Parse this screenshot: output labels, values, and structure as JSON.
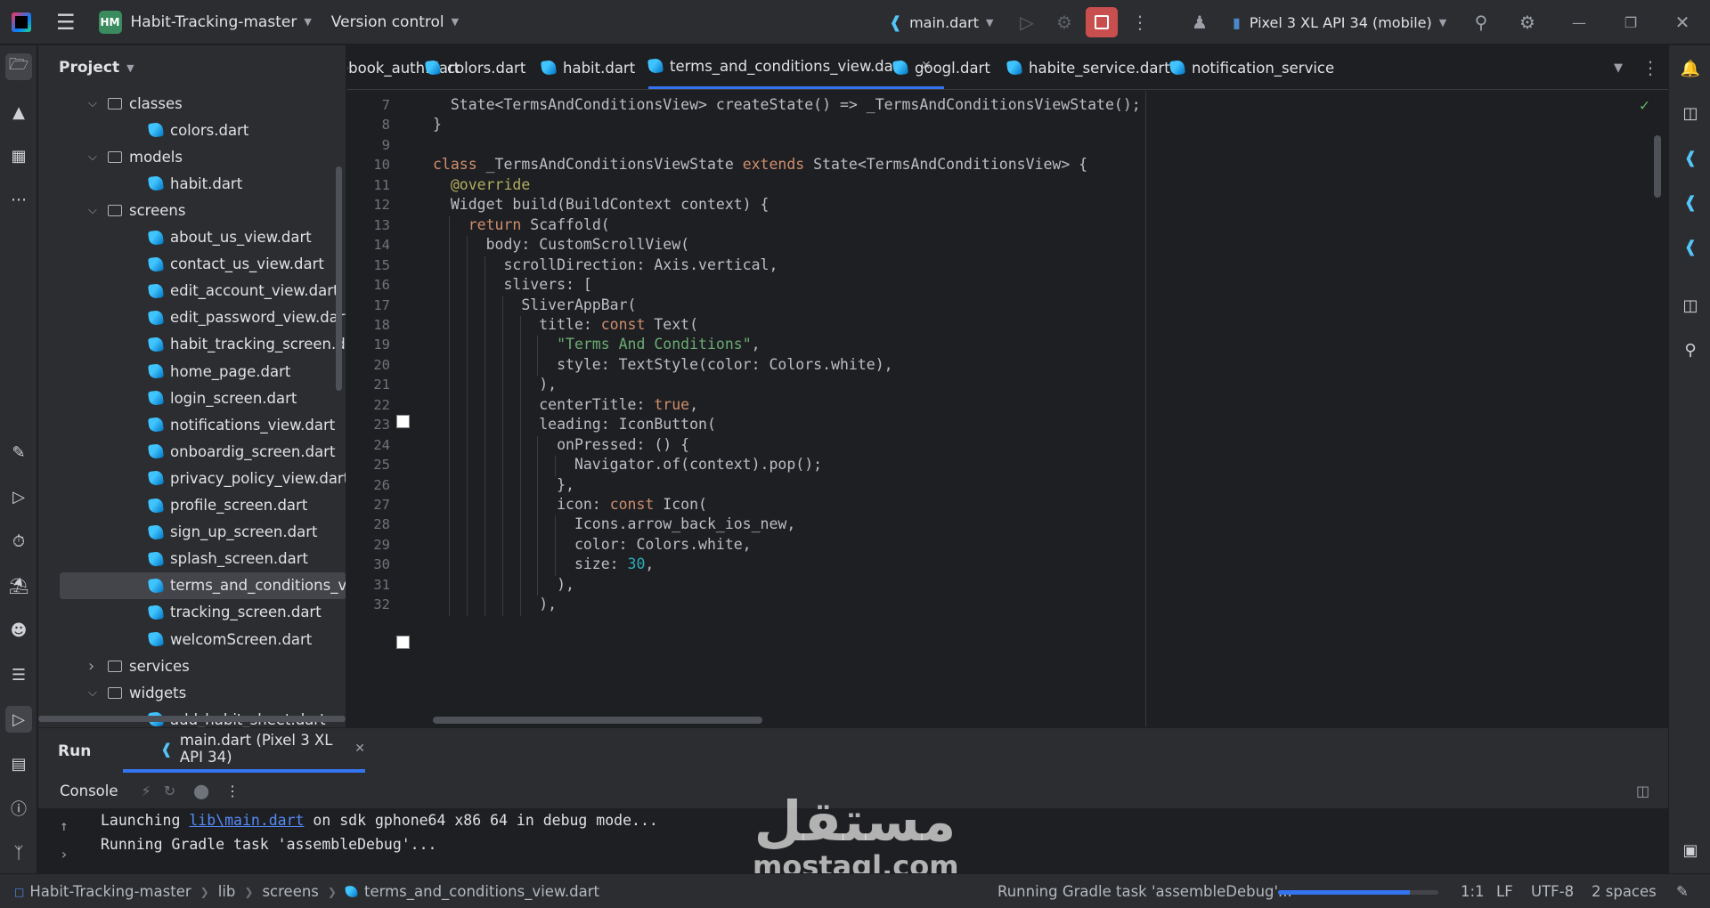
{
  "titlebar": {
    "project_badge": "HM",
    "project_name": "Habit-Tracking-master",
    "version_control": "Version control",
    "run_config": "main.dart",
    "device": "Pixel 3 XL API 34 (mobile)"
  },
  "project_panel": {
    "title": "Project",
    "tree": [
      {
        "label": "classes",
        "type": "folder",
        "expanded": true
      },
      {
        "label": "colors.dart",
        "type": "dart"
      },
      {
        "label": "models",
        "type": "folder",
        "expanded": true
      },
      {
        "label": "habit.dart",
        "type": "dart"
      },
      {
        "label": "screens",
        "type": "folder",
        "expanded": true
      },
      {
        "label": "about_us_view.dart",
        "type": "dart"
      },
      {
        "label": "contact_us_view.dart",
        "type": "dart"
      },
      {
        "label": "edit_account_view.dart",
        "type": "dart"
      },
      {
        "label": "edit_password_view.dart",
        "type": "dart"
      },
      {
        "label": "habit_tracking_screen.dart",
        "type": "dart"
      },
      {
        "label": "home_page.dart",
        "type": "dart"
      },
      {
        "label": "login_screen.dart",
        "type": "dart"
      },
      {
        "label": "notifications_view.dart",
        "type": "dart"
      },
      {
        "label": "onboardig_screen.dart",
        "type": "dart"
      },
      {
        "label": "privacy_policy_view.dart",
        "type": "dart"
      },
      {
        "label": "profile_screen.dart",
        "type": "dart"
      },
      {
        "label": "sign_up_screen.dart",
        "type": "dart"
      },
      {
        "label": "splash_screen.dart",
        "type": "dart"
      },
      {
        "label": "terms_and_conditions_view.dart",
        "type": "dart",
        "selected": true
      },
      {
        "label": "tracking_screen.dart",
        "type": "dart"
      },
      {
        "label": "welcomScreen.dart",
        "type": "dart"
      },
      {
        "label": "services",
        "type": "folder",
        "expanded": false
      },
      {
        "label": "widgets",
        "type": "folder",
        "expanded": true
      },
      {
        "label": "add_habit_sheet.dart",
        "type": "dart"
      }
    ]
  },
  "tabs": [
    {
      "label": "facebook_auth.dart"
    },
    {
      "label": "colors.dart"
    },
    {
      "label": "habit.dart"
    },
    {
      "label": "terms_and_conditions_view.dart",
      "active": true
    },
    {
      "label": "googl.dart"
    },
    {
      "label": "habite_service.dart"
    },
    {
      "label": "notification_service"
    }
  ],
  "editor": {
    "lines": [
      {
        "n": "7",
        "code": "  State<TermsAndConditionsView> createState() => _TermsAndConditionsViewState();"
      },
      {
        "n": "8",
        "code": "}"
      },
      {
        "n": "9",
        "code": ""
      },
      {
        "n": "10",
        "code": "class _TermsAndConditionsViewState extends State<TermsAndConditionsView> {"
      },
      {
        "n": "11",
        "code": "  @override"
      },
      {
        "n": "12",
        "code": "  Widget build(BuildContext context) {"
      },
      {
        "n": "13",
        "code": "    return Scaffold("
      },
      {
        "n": "14",
        "code": "      body: CustomScrollView("
      },
      {
        "n": "15",
        "code": "        scrollDirection: Axis.vertical,"
      },
      {
        "n": "16",
        "code": "        slivers: ["
      },
      {
        "n": "17",
        "code": "          SliverAppBar("
      },
      {
        "n": "18",
        "code": "            title: const Text("
      },
      {
        "n": "19",
        "code": "              \"Terms And Conditions\","
      },
      {
        "n": "20",
        "code": "              style: TextStyle(color: Colors.white),"
      },
      {
        "n": "21",
        "code": "            ),"
      },
      {
        "n": "22",
        "code": "            centerTitle: true,"
      },
      {
        "n": "23",
        "code": "            leading: IconButton("
      },
      {
        "n": "24",
        "code": "              onPressed: () {"
      },
      {
        "n": "25",
        "code": "                Navigator.of(context).pop();"
      },
      {
        "n": "26",
        "code": "              },"
      },
      {
        "n": "27",
        "code": "              icon: const Icon("
      },
      {
        "n": "28",
        "code": "                Icons.arrow_back_ios_new,"
      },
      {
        "n": "29",
        "code": "                color: Colors.white,"
      },
      {
        "n": "30",
        "code": "                size: 30,"
      },
      {
        "n": "31",
        "code": "              ),"
      },
      {
        "n": "32",
        "code": "            ),"
      }
    ]
  },
  "run_panel": {
    "title": "Run",
    "tab_label": "main.dart (Pixel 3 XL API 34)",
    "console_label": "Console",
    "console_lines": [
      {
        "prefix": "Launching ",
        "link": "lib\\main.dart",
        "suffix": " on sdk gphone64 x86 64 in debug mode..."
      },
      {
        "prefix": "Running Gradle task 'assembleDebug'...",
        "link": "",
        "suffix": ""
      }
    ]
  },
  "watermark": {
    "arabic": "مستقل",
    "latin": "mostaql.com"
  },
  "statusbar": {
    "breadcrumb": [
      "Habit-Tracking-master",
      "lib",
      "screens",
      "terms_and_conditions_view.dart"
    ],
    "task": "Running Gradle task 'assembleDebug'...",
    "progress": 0.82,
    "position": "1:1",
    "line_sep": "LF",
    "encoding": "UTF-8",
    "indent": "2 spaces"
  },
  "colors": {
    "accent": "#3574f0",
    "stop": "#c94f4f",
    "keyword": "#cf8e6d",
    "string": "#6aab73",
    "number": "#2aacb8"
  }
}
